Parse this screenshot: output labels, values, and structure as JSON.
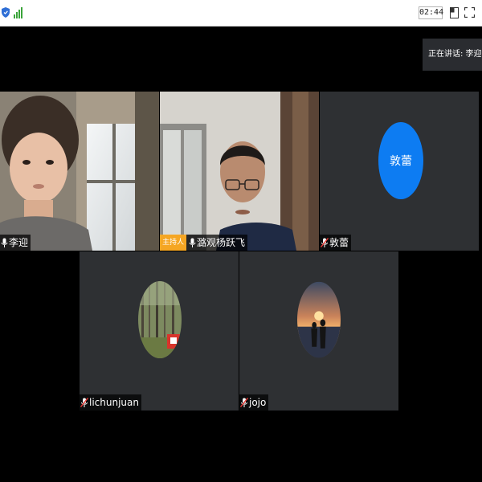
{
  "toolbar": {
    "timer": "02:44",
    "icons": [
      "shield-icon",
      "signal-icon",
      "layout-icon",
      "fullscreen-icon"
    ]
  },
  "speaking": {
    "text": "正在讲话: 李迎; 潞观"
  },
  "participants": [
    {
      "name": "李迎",
      "mic": "on",
      "video": true
    },
    {
      "name": "潞观杨跃飞",
      "host_badge": "主持人",
      "mic": "on",
      "video": true
    },
    {
      "name": "敦蕾",
      "avatar_text": "敦蕾",
      "mic": "off",
      "video": false
    },
    {
      "name": "lichunjuan",
      "mic": "off",
      "video": false,
      "avatar": "photo"
    },
    {
      "name": "jojo",
      "mic": "off",
      "video": false,
      "avatar": "photo"
    }
  ],
  "colors": {
    "background": "#000000",
    "tile": "#2e3033",
    "host_badge": "#f5a623",
    "avatar_blue": "#0d7cf2",
    "signal_green": "#3aa43a"
  }
}
